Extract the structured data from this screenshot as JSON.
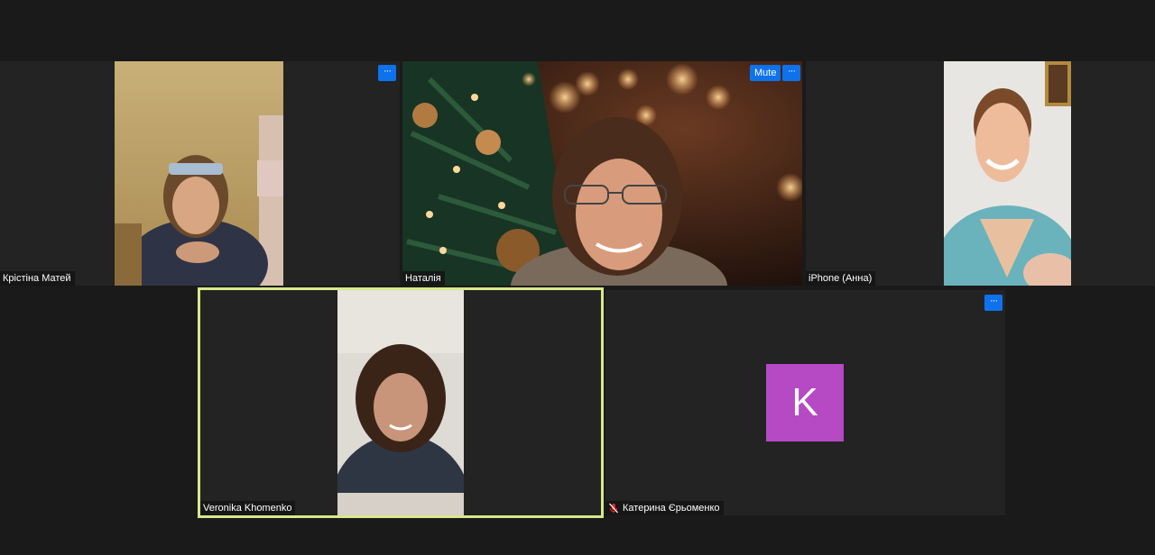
{
  "participants": [
    {
      "name": "Крістіна Матей",
      "more_label": "···"
    },
    {
      "name": "Наталія",
      "mute_label": "Mute",
      "more_label": "···"
    },
    {
      "name": "iPhone (Анна)"
    },
    {
      "name": "Veronika Khomenko"
    },
    {
      "name": "Катерина Єрьоменко",
      "avatar_letter": "K",
      "avatar_color": "#b54ac4",
      "muted": true,
      "more_label": "···"
    }
  ],
  "colors": {
    "active_speaker_border": "#d9e88a",
    "button_blue": "#0e72ed",
    "mic_off_red": "#e02828"
  }
}
